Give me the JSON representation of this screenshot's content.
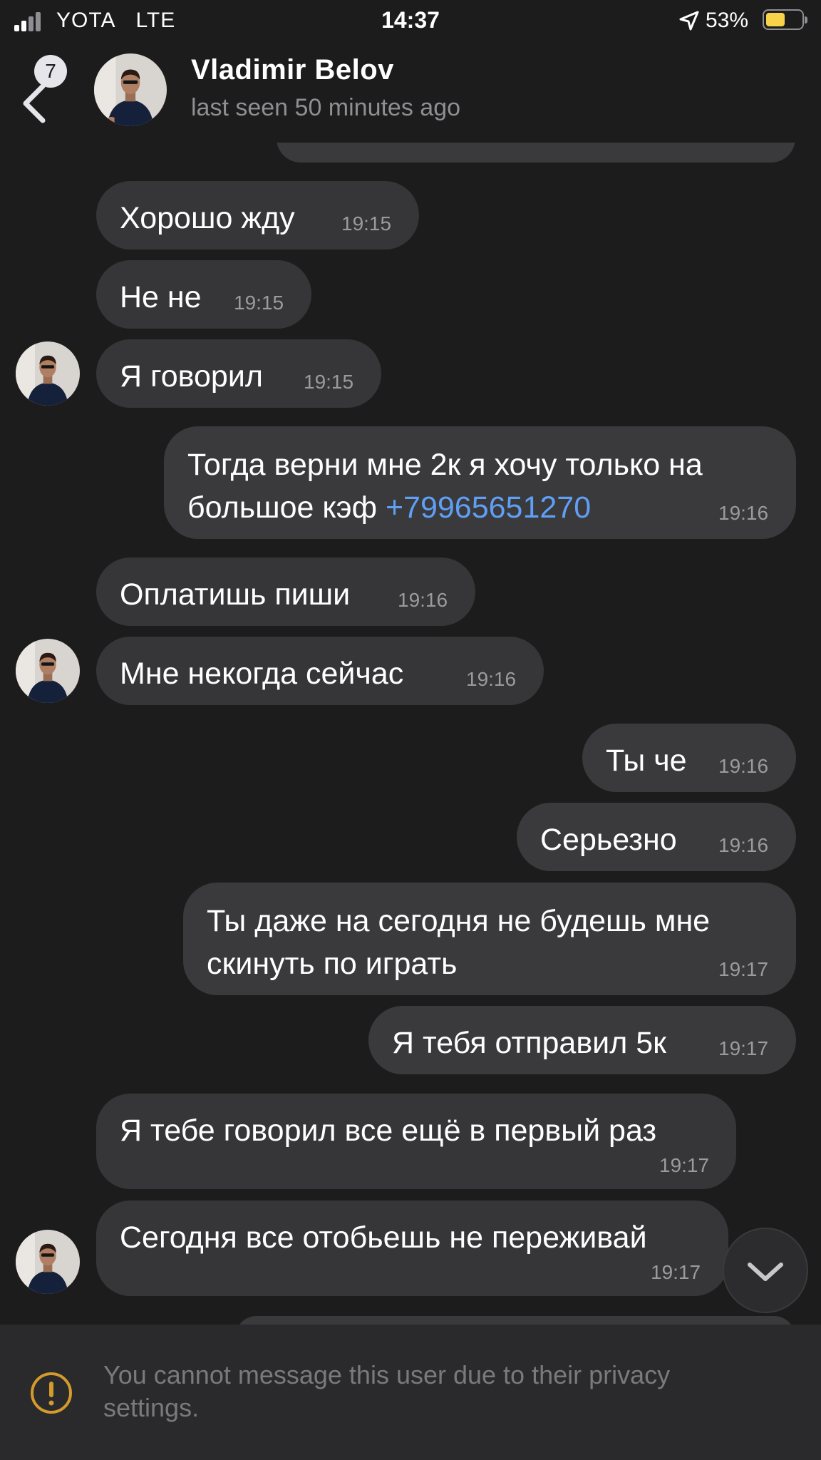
{
  "status_bar": {
    "carrier": "YOTA",
    "network": "LTE",
    "time": "14:37",
    "battery": "53%",
    "battery_level": 0.53
  },
  "header": {
    "back_badge": "7",
    "name": "Vladimir Belov",
    "last_seen": "last seen 50 minutes ago"
  },
  "messages": [
    {
      "dir": "in",
      "text": "Хорошо жду",
      "time": "19:15"
    },
    {
      "dir": "in",
      "text": "Не не",
      "time": "19:15"
    },
    {
      "dir": "in",
      "text": "Я говорил",
      "time": "19:15"
    },
    {
      "dir": "out",
      "line1": "Тогда верни мне 2к я хочу только на",
      "line2_text": "большое кэф",
      "line2_link": "+79965651270",
      "time": "19:16"
    },
    {
      "dir": "in",
      "text": "Оплатишь пиши",
      "time": "19:16"
    },
    {
      "dir": "in",
      "text": "Мне некогда сейчас",
      "time": "19:16"
    },
    {
      "dir": "out",
      "text": "Ты че",
      "time": "19:16"
    },
    {
      "dir": "out",
      "text": "Серьезно",
      "time": "19:16"
    },
    {
      "dir": "out",
      "line1": "Ты даже на сегодня не будешь мне",
      "line2": "скинуть по играть",
      "time": "19:17"
    },
    {
      "dir": "out",
      "text": "Я тебя отправил 5к",
      "time": "19:17"
    },
    {
      "dir": "in",
      "text": "Я тебе говорил все ещё в первый раз",
      "time": "19:17"
    },
    {
      "dir": "in",
      "text": "Сегодня все отобьешь не переживай",
      "time": "19:17"
    }
  ],
  "notice": "You cannot message this user due to their privacy settings.",
  "colors": {
    "background": "#1c1c1d",
    "bubble": "#363638",
    "link": "#5f9ff6",
    "warning": "#d39a2c",
    "battery": "#f7d34a"
  }
}
